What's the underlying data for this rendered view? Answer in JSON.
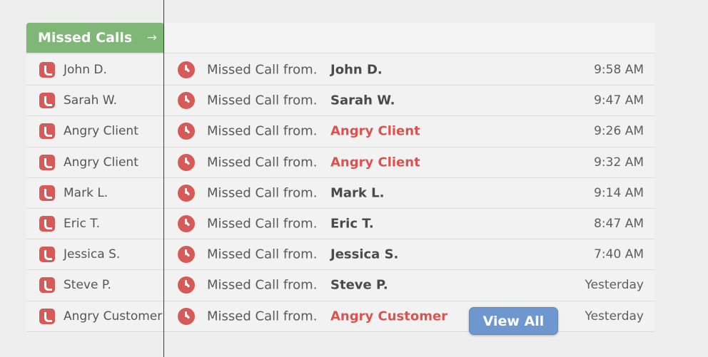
{
  "header": {
    "title": "Missed Calls",
    "arrow_glyph": "→",
    "color": "#7fb876"
  },
  "message_prefix": "Missed Call from.",
  "rows": [
    {
      "short_name": "John D.",
      "caller": "John D.",
      "time": "9:58 AM",
      "angry": false
    },
    {
      "short_name": "Sarah W.",
      "caller": "Sarah W.",
      "time": "9:47 AM",
      "angry": false
    },
    {
      "short_name": "Angry Client",
      "caller": "Angry Client",
      "time": "9:26 AM",
      "angry": true
    },
    {
      "short_name": "Angry Client",
      "caller": "Angry Client",
      "time": "9:32 AM",
      "angry": true
    },
    {
      "short_name": "Mark L.",
      "caller": "Mark L.",
      "time": "9:14 AM",
      "angry": false
    },
    {
      "short_name": "Eric T.",
      "caller": "Eric T.",
      "time": "8:47 AM",
      "angry": false
    },
    {
      "short_name": "Jessica S.",
      "caller": "Jessica S.",
      "time": "7:40 AM",
      "angry": false
    },
    {
      "short_name": "Steve P.",
      "caller": "Steve P.",
      "time": "Yesterday",
      "angry": false
    },
    {
      "short_name": "Angry Customer",
      "caller": "Angry Customer",
      "time": "Yesterday",
      "angry": true
    }
  ],
  "view_all_label": "View All",
  "colors": {
    "alert_red": "#d55a58",
    "angry_text": "#d9534f",
    "button_blue": "#6f97cf"
  },
  "icons": {
    "row_left": "phone-missed-icon",
    "row_right": "clock-icon"
  }
}
